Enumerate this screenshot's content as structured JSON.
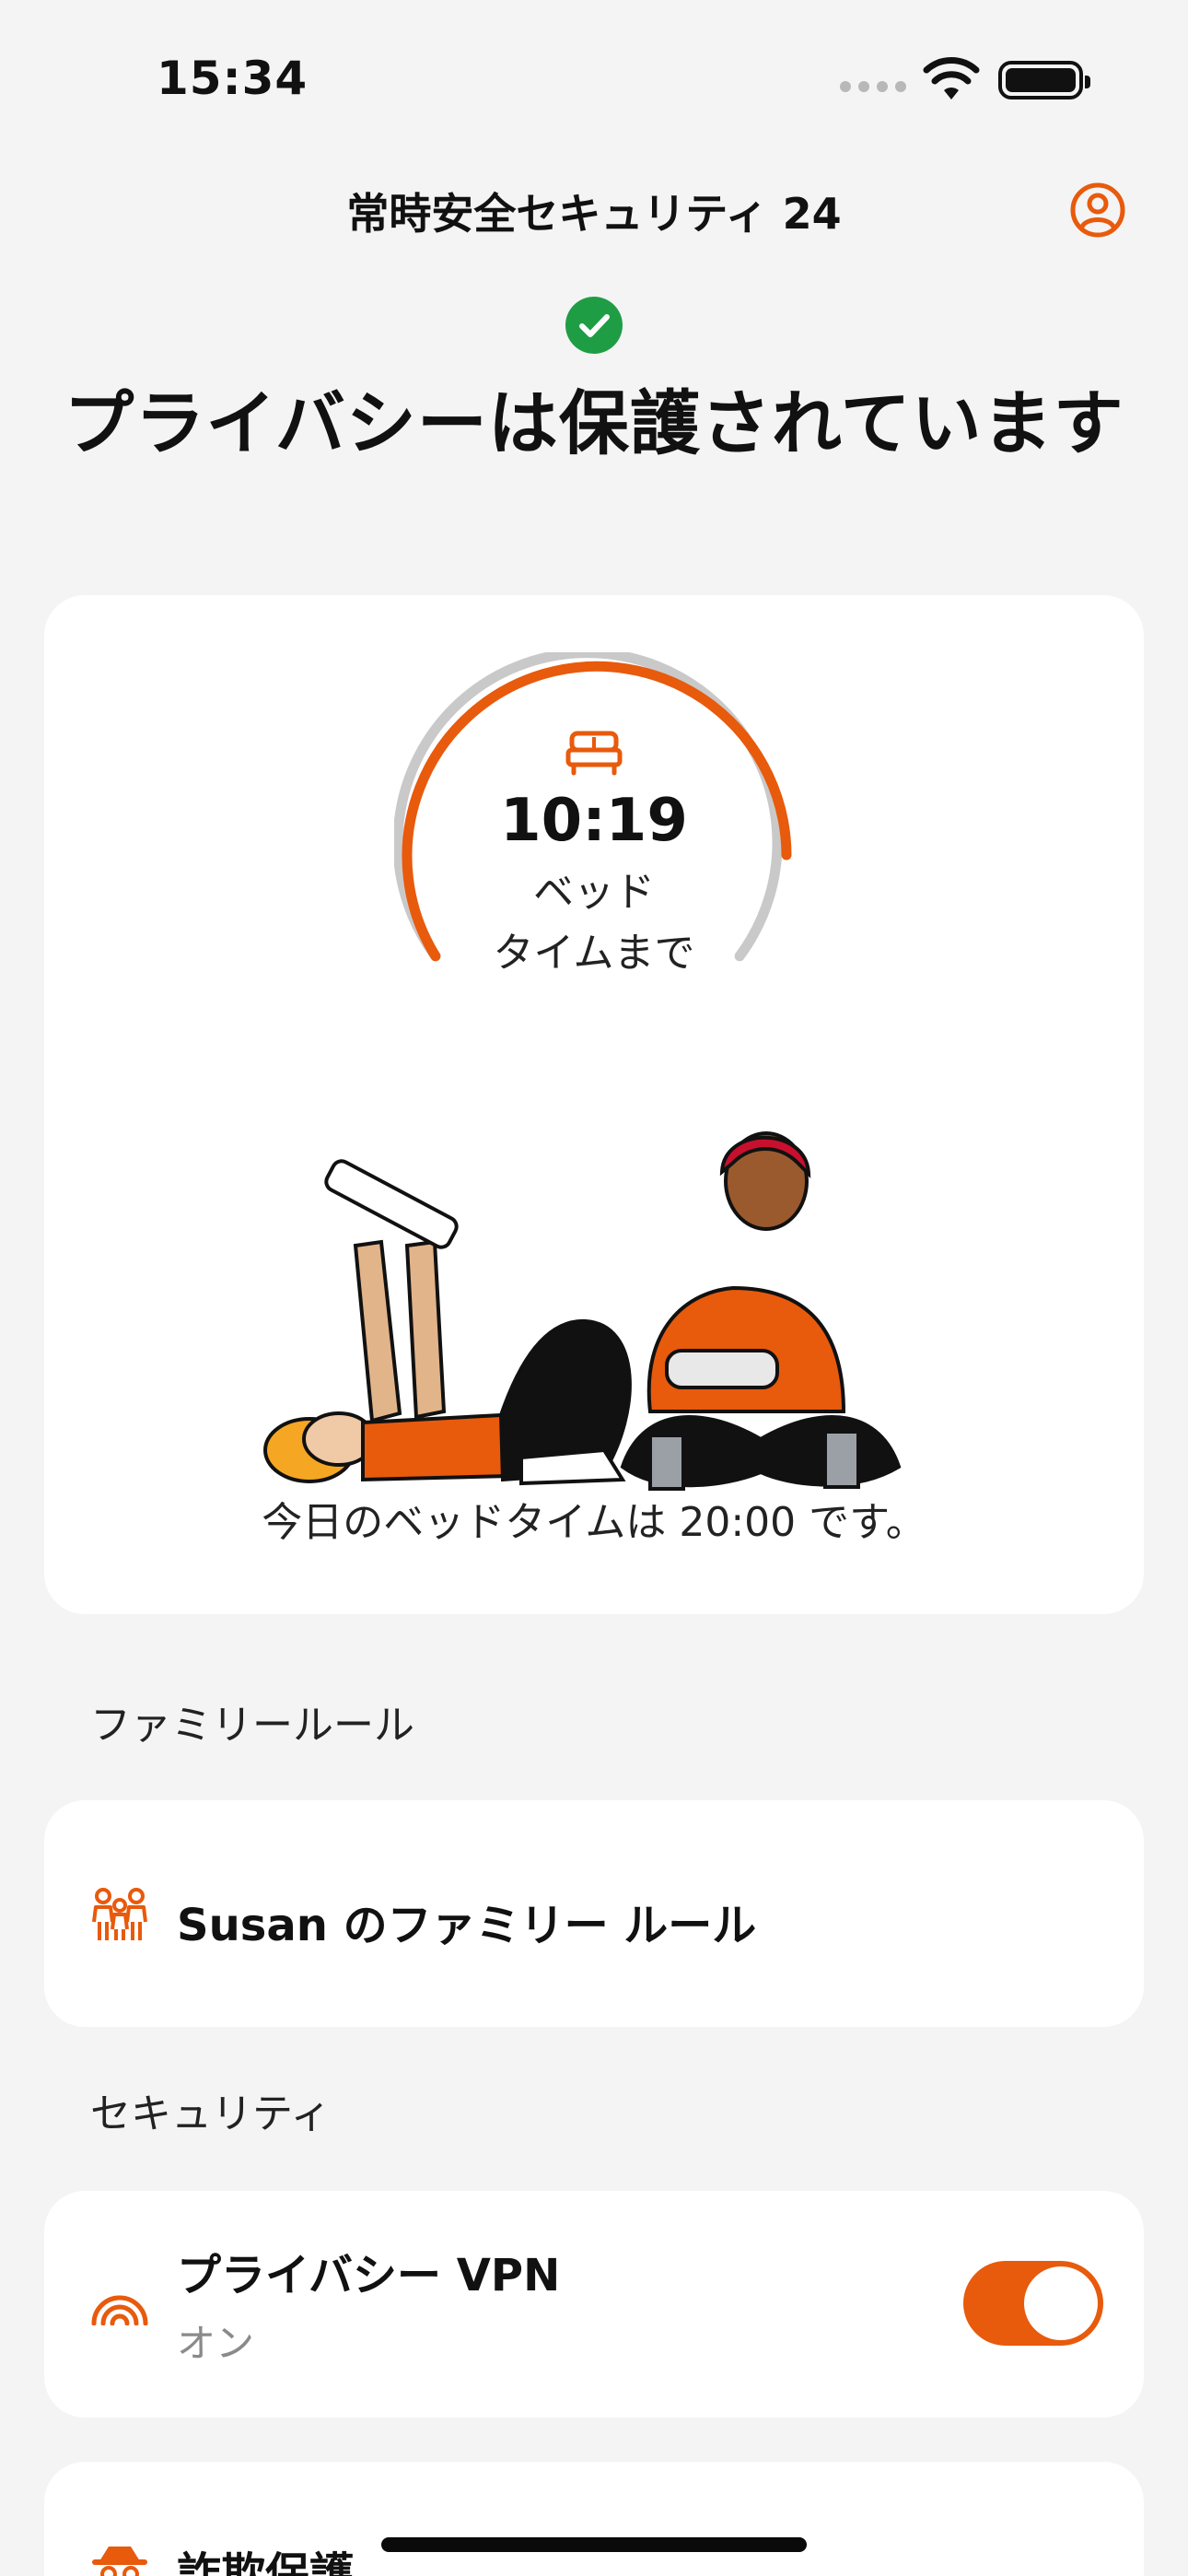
{
  "status_bar": {
    "time": "15:34"
  },
  "header": {
    "title": "常時安全セキュリティ 24"
  },
  "hero": {
    "title": "プライバシーは保護されています"
  },
  "bedtime": {
    "countdown": "10:19",
    "label_line1": "ベッド",
    "label_line2": "タイムまで",
    "note": "今日のベッドタイムは 20:00 です。"
  },
  "family_section": {
    "heading": "ファミリールール",
    "item_label": "Susan のファミリー ルール"
  },
  "security_section": {
    "heading": "セキュリティ",
    "vpn": {
      "title": "プライバシー VPN",
      "status": "オン",
      "enabled": true
    },
    "fraud": {
      "title": "詐欺保護"
    }
  },
  "colors": {
    "accent": "#e85a0c",
    "success": "#1f9d45",
    "background": "#f4f4f4",
    "card": "#ffffff"
  }
}
